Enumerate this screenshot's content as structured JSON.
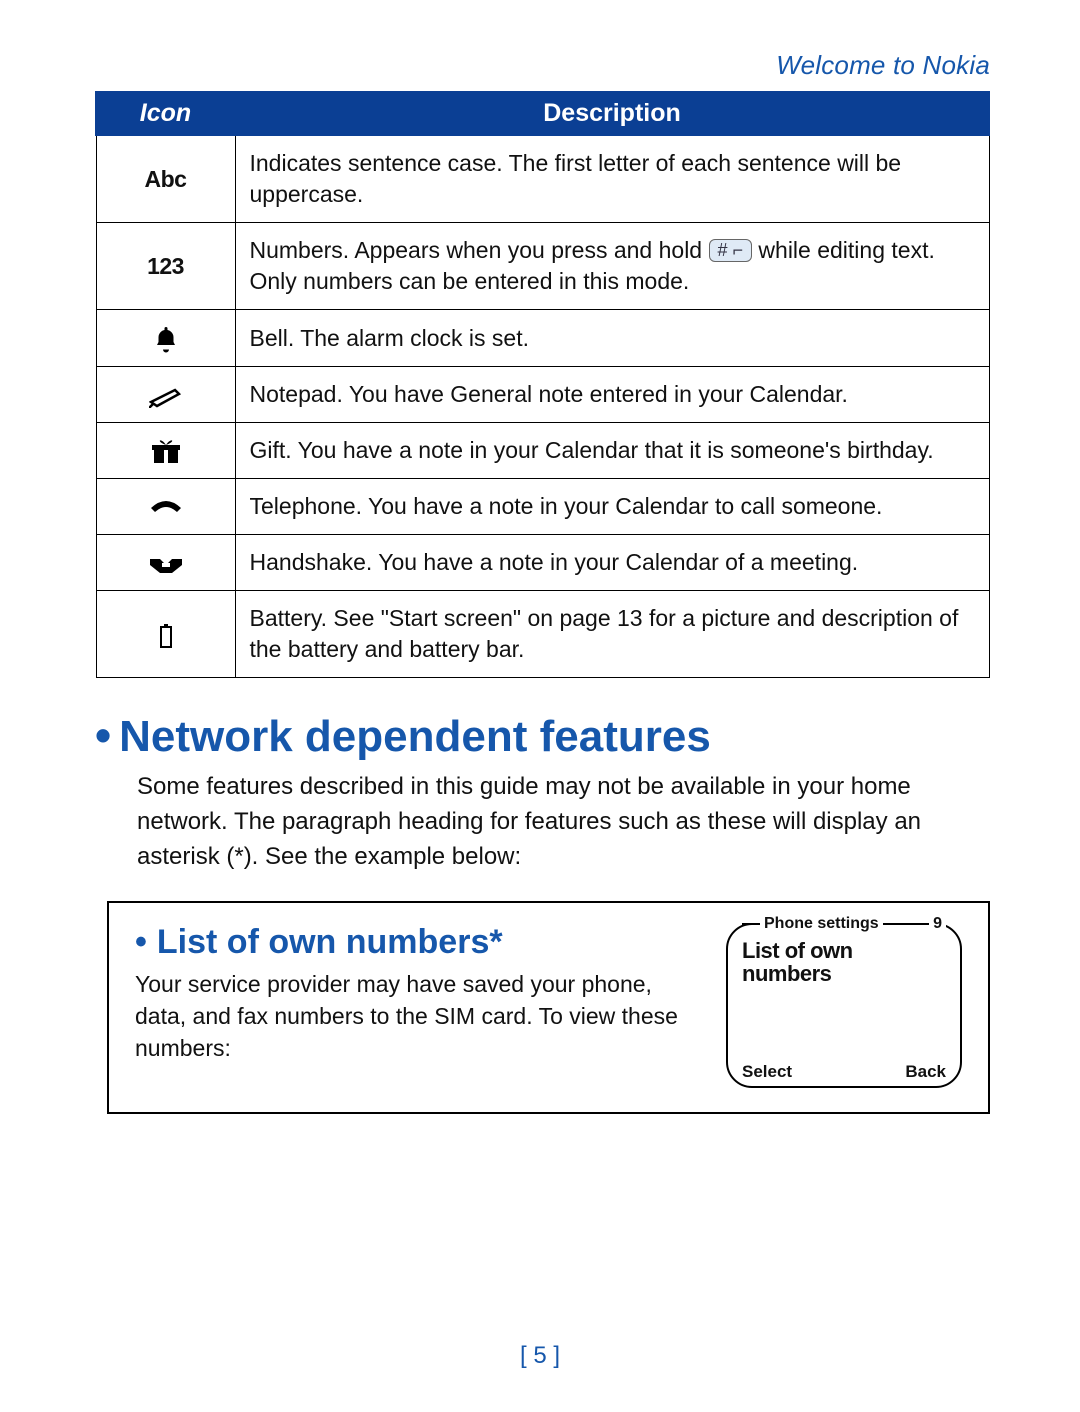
{
  "header": {
    "title": "Welcome to Nokia"
  },
  "table": {
    "headers": {
      "icon": "Icon",
      "description": "Description"
    },
    "rows": [
      {
        "iconLabel": "Abc",
        "desc": "Indicates sentence case. The first letter of each sentence will be uppercase."
      },
      {
        "iconLabel": "123",
        "desc_pre": "Numbers. Appears when you press and hold ",
        "key": "# ⌐",
        "desc_post": " while editing text. Only numbers can be entered in this mode."
      },
      {
        "iconName": "bell-icon",
        "desc": "Bell. The alarm clock is set."
      },
      {
        "iconName": "notepad-icon",
        "desc": "Notepad. You have General note entered in your Calendar."
      },
      {
        "iconName": "gift-icon",
        "desc": "Gift. You have a note in your Calendar that it is someone's birthday."
      },
      {
        "iconName": "telephone-icon",
        "desc": "Telephone. You have a note in your Calendar to call someone."
      },
      {
        "iconName": "handshake-icon",
        "desc": "Handshake. You have a note in your Calendar of a meeting."
      },
      {
        "iconName": "battery-icon",
        "desc": "Battery. See \"Start screen\" on page 13 for a picture and description of the battery and battery bar."
      }
    ]
  },
  "section": {
    "title": "Network dependent features",
    "body": "Some features described in this guide may not be available in your home network. The paragraph heading for features such as these will display an asterisk (*). See the example below:"
  },
  "example": {
    "title": "List of own numbers*",
    "body": "Your service provider may have saved your phone, data, and fax numbers to the SIM card. To view these numbers:",
    "phone": {
      "menuTitle": "Phone settings",
      "menuIndex": "9",
      "item": "List of own numbers",
      "softLeft": "Select",
      "softRight": "Back"
    }
  },
  "pageNumber": "[ 5 ]"
}
